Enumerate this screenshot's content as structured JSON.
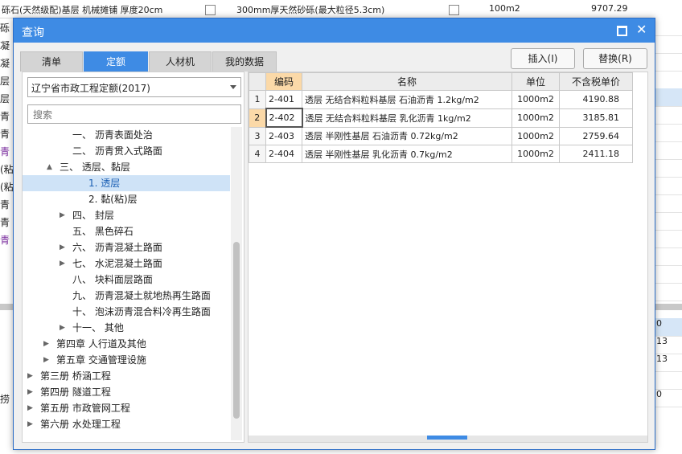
{
  "background": {
    "top_row": {
      "left_text": "砾石(天然级配)基层 机械摊铺 厚度20cm",
      "mid_text": "300mm厚天然砂砾(最大粒径5.3cm)",
      "unit": "100m2",
      "value": "9707.29"
    },
    "left_rows": [
      "砾",
      "凝",
      "凝",
      "层",
      "层",
      "青",
      "青",
      "青",
      "(粘",
      "(粘",
      "青",
      "青",
      "青",
      "",
      "",
      "",
      "",
      "",
      "",
      "",
      "",
      "捞"
    ],
    "right_rows": [
      "",
      "",
      "",
      "",
      "",
      "",
      "",
      "",
      "",
      "",
      "",
      "",
      "",
      "",
      "",
      "",
      "",
      "0",
      "13",
      "13",
      "",
      "0"
    ]
  },
  "dialog": {
    "title": "查询",
    "tabs": [
      "清单",
      "定额",
      "人材机",
      "我的数据"
    ],
    "active_tab": 1,
    "buttons": {
      "insert": "插入(I)",
      "replace": "替换(R)"
    },
    "quota_select": "辽宁省市政工程定额(2017)",
    "search_placeholder": "搜索",
    "tree": [
      {
        "label": "一、 沥青表面处治",
        "arrow": ""
      },
      {
        "label": "二、 沥青贯入式路面",
        "arrow": ""
      },
      {
        "label": "三、 透层、黏层",
        "arrow": "▲"
      },
      {
        "label": "1. 透层",
        "arrow": "",
        "selected": true
      },
      {
        "label": "2. 黏(粘)层",
        "arrow": ""
      },
      {
        "label": "四、 封层",
        "arrow": "▶"
      },
      {
        "label": "五、 黑色碎石",
        "arrow": ""
      },
      {
        "label": "六、 沥青混凝土路面",
        "arrow": "▶"
      },
      {
        "label": "七、 水泥混凝土路面",
        "arrow": "▶"
      },
      {
        "label": "八、 块料面层路面",
        "arrow": ""
      },
      {
        "label": "九、 沥青混凝土就地热再生路面",
        "arrow": ""
      },
      {
        "label": "十、 泡沫沥青混合料冷再生路面",
        "arrow": ""
      },
      {
        "label": "十一、 其他",
        "arrow": "▶"
      },
      {
        "label": "第四章 人行道及其他",
        "arrow": "▶"
      },
      {
        "label": "第五章 交通管理设施",
        "arrow": "▶"
      },
      {
        "label": "第三册 桥涵工程",
        "arrow": "▶"
      },
      {
        "label": "第四册 隧道工程",
        "arrow": "▶"
      },
      {
        "label": "第五册 市政管网工程",
        "arrow": "▶"
      },
      {
        "label": "第六册 水处理工程",
        "arrow": "▶"
      }
    ],
    "table": {
      "headers": [
        "",
        "编码",
        "名称",
        "单位",
        "不含税单价"
      ],
      "rows": [
        {
          "idx": "1",
          "code": "2-401",
          "name": "透层 无结合料粒料基层 石油沥青 1.2kg/m2",
          "unit": "1000m2",
          "price": "4190.88"
        },
        {
          "idx": "2",
          "code": "2-402",
          "name": "透层 无结合料粒料基层 乳化沥青 1kg/m2",
          "unit": "1000m2",
          "price": "3185.81"
        },
        {
          "idx": "3",
          "code": "2-403",
          "name": "透层 半刚性基层 石油沥青 0.72kg/m2",
          "unit": "1000m2",
          "price": "2759.64"
        },
        {
          "idx": "4",
          "code": "2-404",
          "name": "透层 半刚性基层 乳化沥青 0.7kg/m2",
          "unit": "1000m2",
          "price": "2411.18"
        }
      ]
    }
  }
}
